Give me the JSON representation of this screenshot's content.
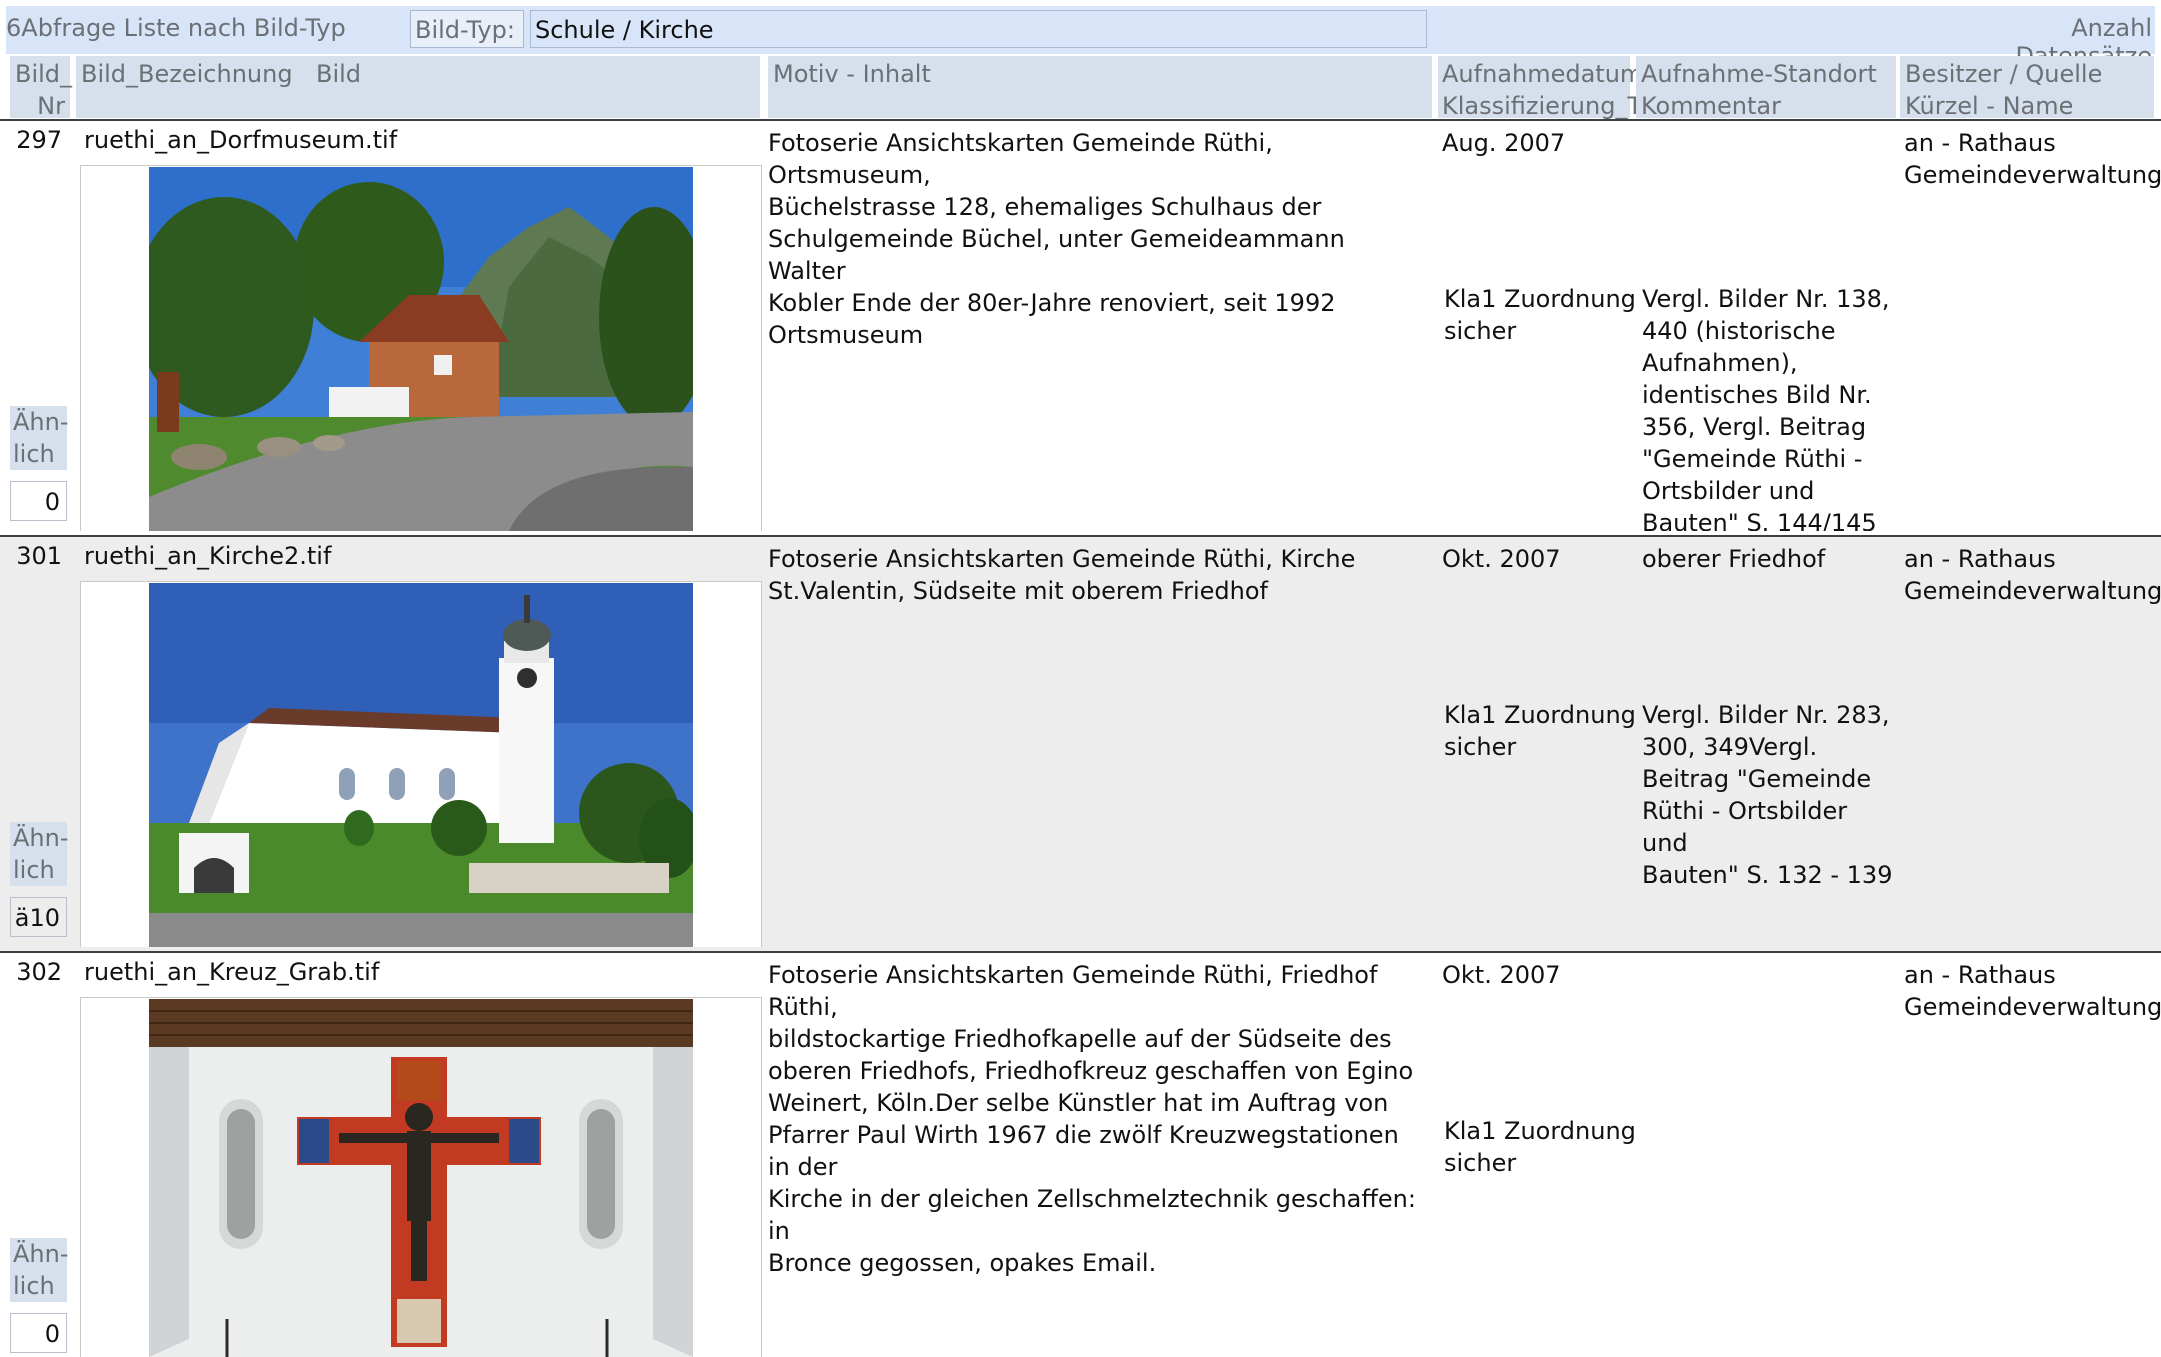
{
  "header": {
    "title": "6Abfrage Liste nach Bild-Typ",
    "bildtyp_label": "Bild-Typ:",
    "bildtyp_value": "Schule / Kirche",
    "anzahl_label": "Anzahl Datensätze"
  },
  "columns": {
    "nr_line1": "Bild_",
    "nr_line2": "Nr",
    "bezeichnung": "Bild_Bezeichnung",
    "bild": "Bild",
    "motiv": "Motiv - Inhalt",
    "datum_line1": "Aufnahmedatum",
    "datum_line2": "Klassifizierung_T",
    "standort_line1": "Aufnahme-Standort",
    "standort_line2": "Kommentar",
    "besitzer_line1": "Besitzer / Quelle",
    "besitzer_line2": "Kürzel - Name"
  },
  "records": [
    {
      "nr": "297",
      "filename": "ruethi_an_Dorfmuseum.tif",
      "image": "photo-dorfmuseum",
      "motiv_lines": [
        "Fotoserie Ansichtskarten Gemeinde Rüthi, Ortsmuseum,",
        "Büchelstrasse 128, ehemaliges Schulhaus der",
        "Schulgemeinde Büchel, unter Gemeideammann Walter",
        "Kobler Ende der 80er-Jahre renoviert, seit 1992",
        "Ortsmuseum"
      ],
      "datum": "Aug. 2007",
      "standort": "",
      "klass_lines": [
        "Kla1 Zuordnung",
        "sicher"
      ],
      "kommentar_lines": [
        "Vergl. Bilder Nr. 138,",
        "440 (historische",
        "Aufnahmen),",
        "identisches Bild Nr.",
        "356, Vergl. Beitrag",
        "\"Gemeinde Rüthi -",
        "Ortsbilder und",
        "Bauten\" S. 144/145"
      ],
      "besitzer_lines": [
        "an - Rathaus",
        "Gemeindeverwaltung"
      ],
      "ahnlich_lines": [
        "Ähn-",
        "lich"
      ],
      "count": "0"
    },
    {
      "nr": "301",
      "filename": "ruethi_an_Kirche2.tif",
      "image": "photo-kirche",
      "motiv_lines": [
        "Fotoserie Ansichtskarten Gemeinde Rüthi, Kirche",
        "St.Valentin, Südseite mit oberem Friedhof"
      ],
      "datum": "Okt. 2007",
      "standort": "oberer Friedhof",
      "klass_lines": [
        "Kla1 Zuordnung",
        "sicher"
      ],
      "kommentar_lines": [
        "Vergl. Bilder Nr. 283,",
        "300, 349Vergl.",
        "Beitrag \"Gemeinde",
        "Rüthi - Ortsbilder und",
        "Bauten\" S. 132 - 139"
      ],
      "besitzer_lines": [
        "an - Rathaus",
        "Gemeindeverwaltung"
      ],
      "ahnlich_lines": [
        "Ähn-",
        "lich"
      ],
      "count": "ä10"
    },
    {
      "nr": "302",
      "filename": "ruethi_an_Kreuz_Grab.tif",
      "image": "photo-kreuz",
      "motiv_lines": [
        "Fotoserie Ansichtskarten Gemeinde Rüthi, Friedhof Rüthi,",
        "bildstockartige Friedhofkapelle auf der Südseite des",
        "oberen Friedhofs, Friedhofkreuz geschaffen von Egino",
        "Weinert, Köln.Der selbe Künstler hat im Auftrag von",
        "Pfarrer Paul Wirth 1967 die zwölf Kreuzwegstationen in der",
        "Kirche in der gleichen Zellschmelztechnik geschaffen: in",
        "Bronce gegossen, opakes Email."
      ],
      "datum": "Okt. 2007",
      "standort": "",
      "klass_lines": [
        "Kla1 Zuordnung",
        "sicher"
      ],
      "kommentar_lines": [],
      "besitzer_lines": [
        "an - Rathaus",
        "Gemeindeverwaltung"
      ],
      "ahnlich_lines": [
        "Ähn-",
        "lich"
      ],
      "count": "0"
    }
  ]
}
